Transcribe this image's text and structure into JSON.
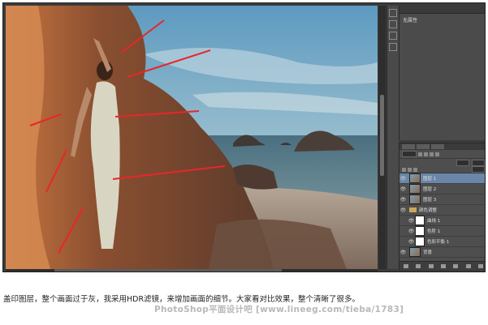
{
  "properties_panel": {
    "title": "无属性"
  },
  "layers_panel": {
    "layers": [
      {
        "name": "图层 1",
        "selected": true,
        "type": "image"
      },
      {
        "name": "图层 2",
        "selected": false,
        "type": "image"
      },
      {
        "name": "图层 3",
        "selected": false,
        "type": "image"
      },
      {
        "name": "颜色调整",
        "selected": false,
        "type": "group"
      },
      {
        "name": "曲线 1",
        "selected": false,
        "type": "adjustment"
      },
      {
        "name": "色阶 1",
        "selected": false,
        "type": "adjustment"
      },
      {
        "name": "色彩平衡 1",
        "selected": false,
        "type": "adjustment"
      },
      {
        "name": "背景",
        "selected": false,
        "type": "image"
      }
    ]
  },
  "caption": "盖印图层，整个画面过于灰，我采用HDR滤镜，来增加画面的细节。大家看对比效果，整个清晰了很多。",
  "watermark": "PhotoShop平面设计吧 [www.lineeg.com/tieba/1783]",
  "colors": {
    "sky": "#6fa5bf",
    "rock": "#7a4a2e",
    "arrow": "#e8262a",
    "panel": "#4b4b4b",
    "selected": "#6a86a8"
  }
}
